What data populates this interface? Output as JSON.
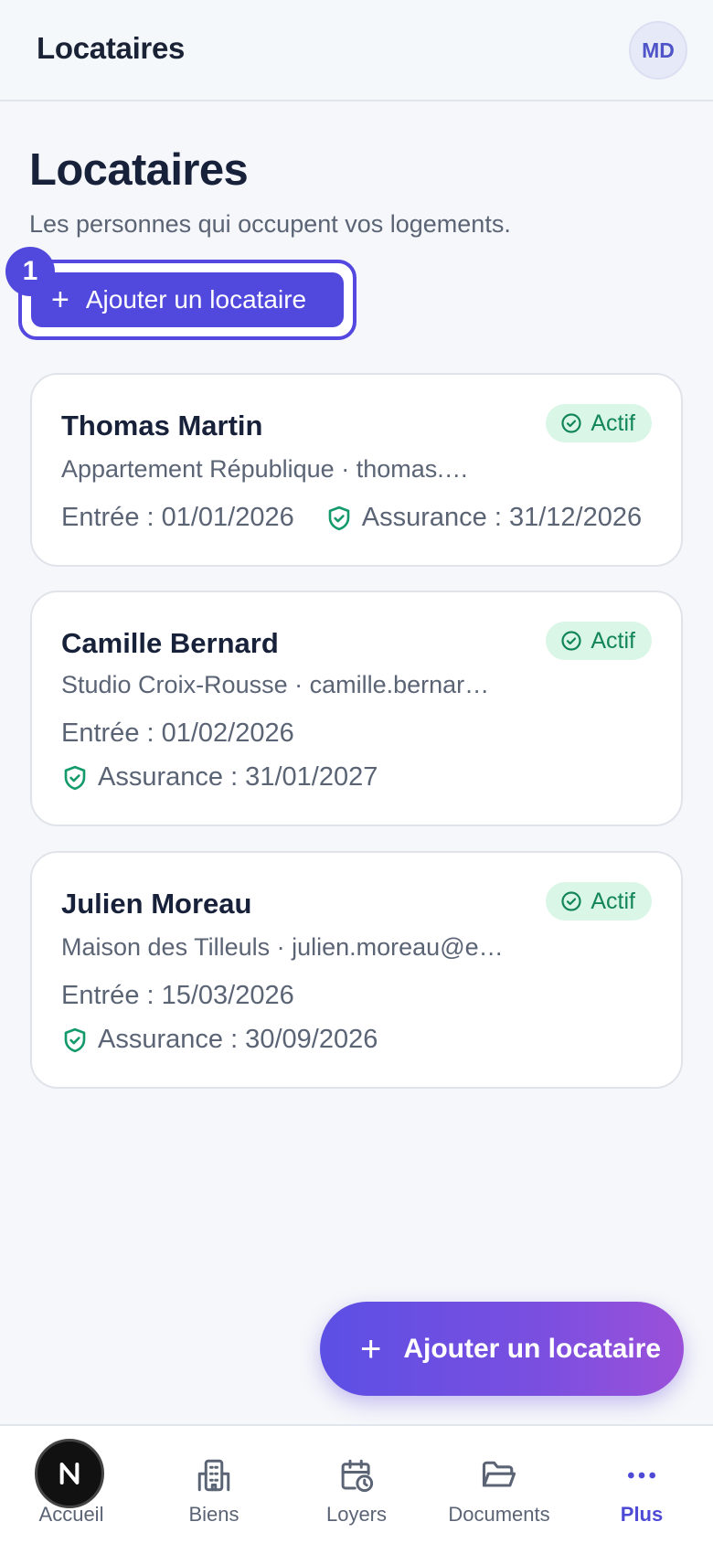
{
  "topbar": {
    "title": "Locataires",
    "avatar_initials": "MD"
  },
  "page": {
    "title": "Locataires",
    "subtitle": "Les personnes qui occupent vos logements.",
    "add_button_label": "Ajouter un locataire",
    "step_badge": "1"
  },
  "tenants": [
    {
      "name": "Thomas Martin",
      "status": "Actif",
      "details": "Appartement République · thomas.…",
      "entry": "Entrée : 01/01/2026",
      "insurance": "Assurance : 31/12/2026"
    },
    {
      "name": "Camille Bernard",
      "status": "Actif",
      "details": "Studio Croix-Rousse · camille.bernar…",
      "entry": "Entrée : 01/02/2026",
      "insurance": "Assurance : 31/01/2027"
    },
    {
      "name": "Julien Moreau",
      "status": "Actif",
      "details": "Maison des Tilleuls · julien.moreau@e…",
      "entry": "Entrée : 15/03/2026",
      "insurance": "Assurance : 30/09/2026"
    }
  ],
  "fab": {
    "label": "Ajouter un locataire"
  },
  "nav": {
    "items": [
      {
        "label": "Accueil",
        "icon": "home-icon"
      },
      {
        "label": "Biens",
        "icon": "building-icon"
      },
      {
        "label": "Loyers",
        "icon": "calendar-clock-icon"
      },
      {
        "label": "Documents",
        "icon": "folder-icon"
      },
      {
        "label": "Plus",
        "icon": "more-icon"
      }
    ],
    "active": "Plus"
  },
  "colors": {
    "accent": "#5149de",
    "status_bg": "#d9f6e6",
    "status_text": "#13855a",
    "insurance_icon": "#139a6a"
  }
}
